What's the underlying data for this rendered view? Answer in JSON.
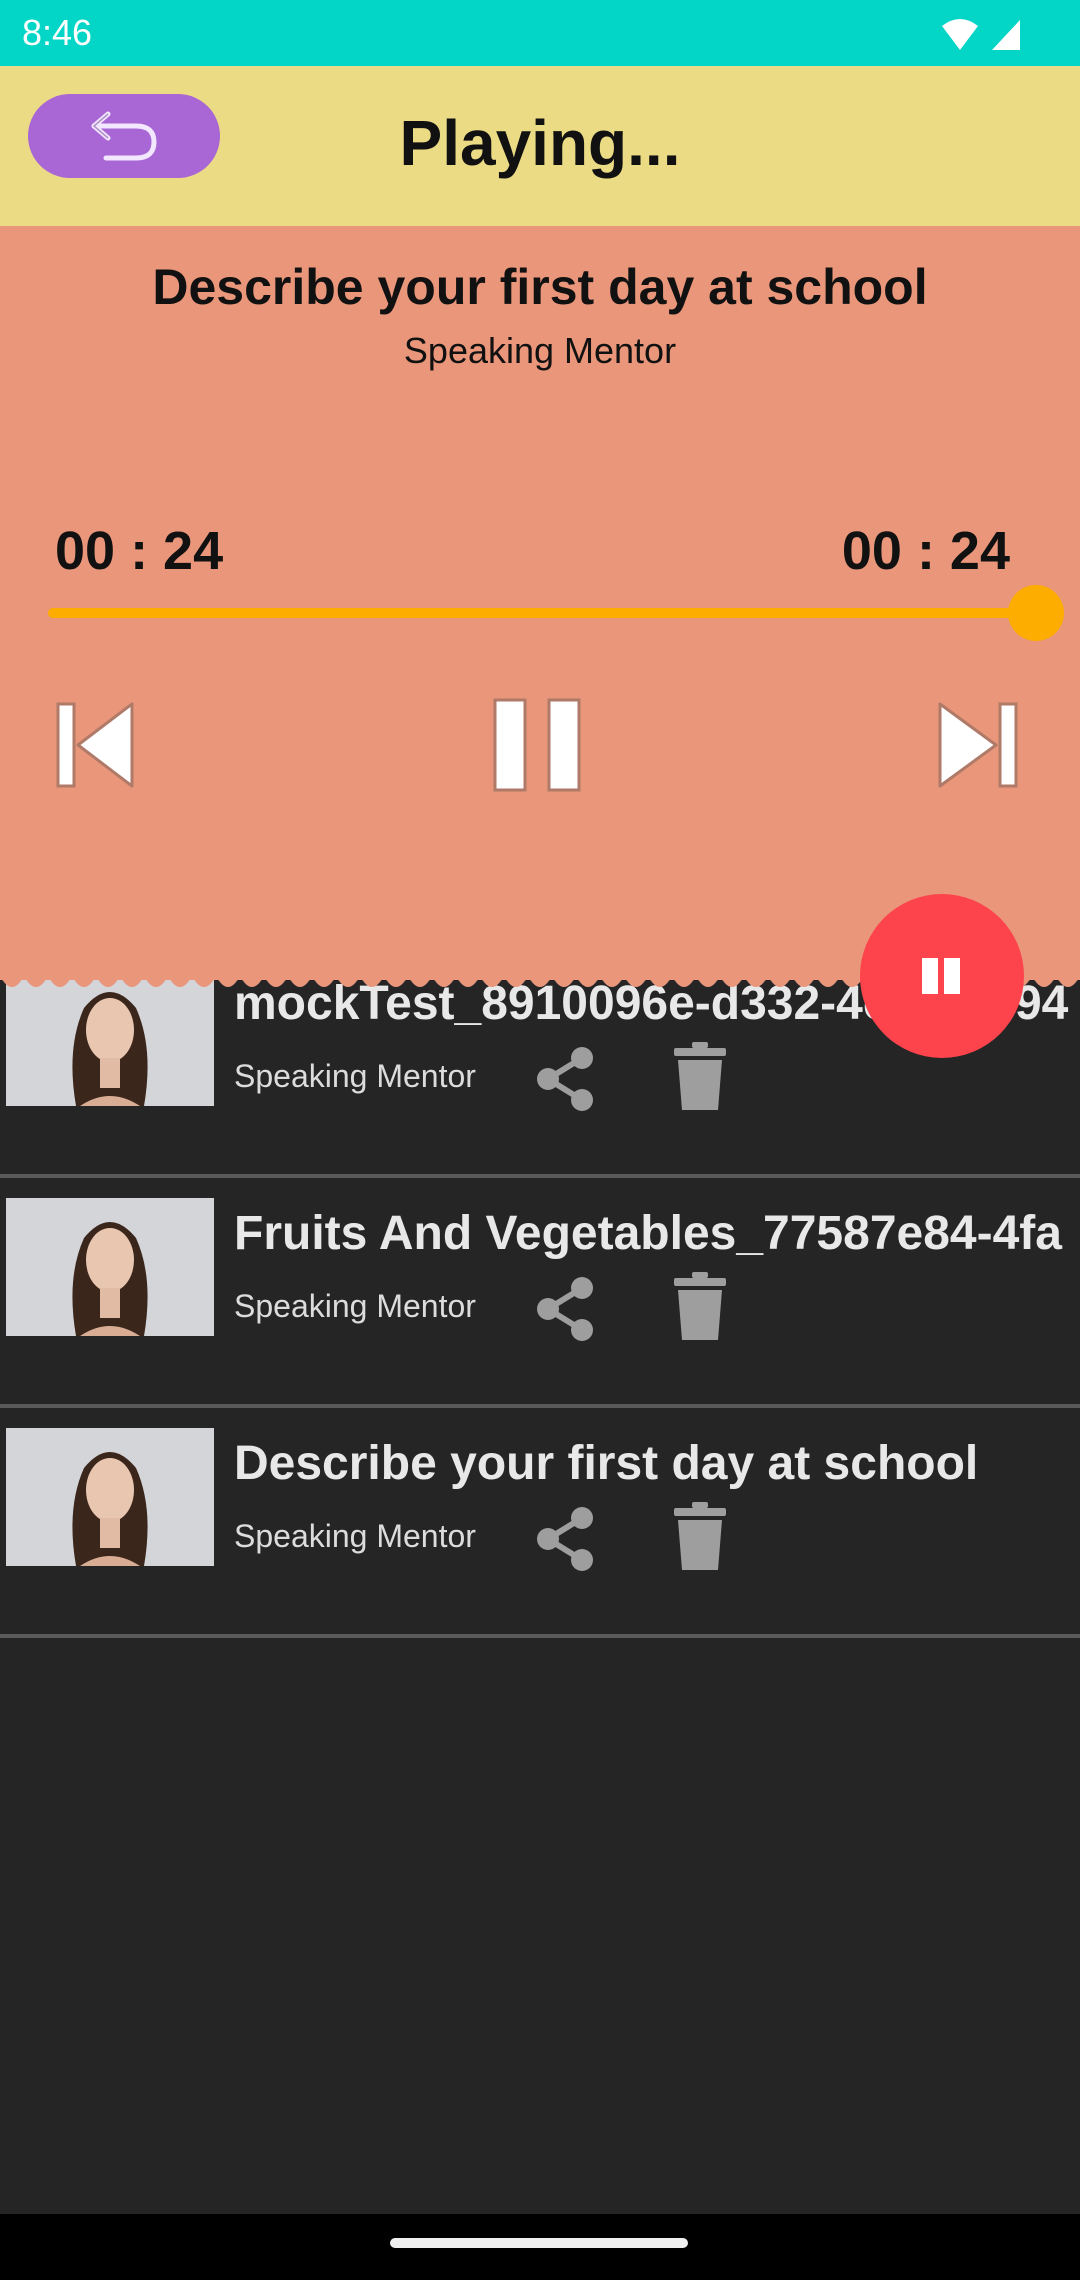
{
  "status_bar": {
    "time": "8:46"
  },
  "header": {
    "title": "Playing..."
  },
  "player": {
    "track_title": "Describe your first day at school",
    "track_subtitle": "Speaking Mentor",
    "elapsed": "00 : 24",
    "duration": "00 : 24",
    "progress_fraction": 1.0
  },
  "recordings": [
    {
      "title": "mockTest_8910096e-d332-4c7a-8d94",
      "author": "Speaking Mentor"
    },
    {
      "title": "Fruits And Vegetables_77587e84-4fa",
      "author": "Speaking Mentor"
    },
    {
      "title": "Describe your first day at school",
      "author": "Speaking Mentor"
    }
  ],
  "colors": {
    "status_bar": "#03d5c6",
    "header": "#ecdb85",
    "player": "#e9967a",
    "accent": "#fcad00",
    "back_button": "#a867d4",
    "fab": "#fd434b",
    "list_background": "#252525"
  },
  "icons": {
    "back": "undo-arrow-icon",
    "prev": "skip-previous-icon",
    "pause": "pause-icon",
    "next": "skip-next-icon",
    "fab": "pause-icon",
    "share": "share-icon",
    "delete": "trash-icon"
  }
}
